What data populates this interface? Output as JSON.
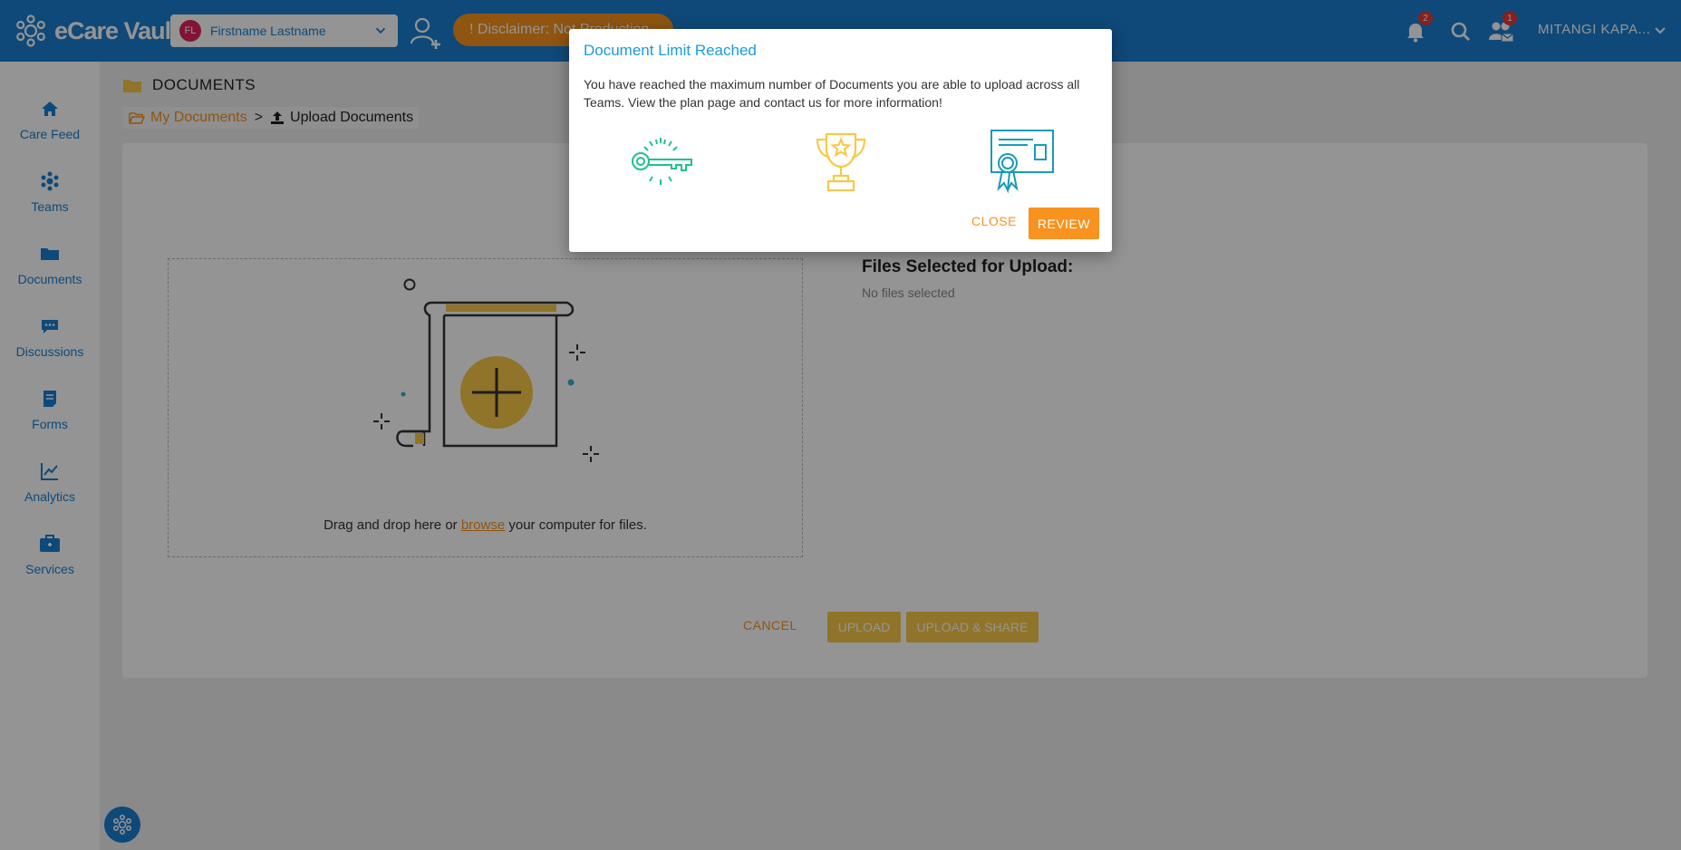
{
  "app": {
    "name": "eCare Vault"
  },
  "header": {
    "team_initials": "FL",
    "team_name": "Firstname Lastname",
    "disclaimer": "! Disclaimer: Not Production",
    "notifications_count": "2",
    "team_requests_count": "1",
    "user_name": "MITANGI KAPA..."
  },
  "sidebar": {
    "items": [
      {
        "label": "Care Feed",
        "icon": "home-icon"
      },
      {
        "label": "Teams",
        "icon": "teams-icon"
      },
      {
        "label": "Documents",
        "icon": "folder-icon"
      },
      {
        "label": "Discussions",
        "icon": "chat-icon"
      },
      {
        "label": "Forms",
        "icon": "form-icon"
      },
      {
        "label": "Analytics",
        "icon": "chart-icon"
      },
      {
        "label": "Services",
        "icon": "briefcase-icon"
      }
    ]
  },
  "page": {
    "title": "DOCUMENTS",
    "breadcrumb": {
      "parent": "My Documents",
      "separator": ">",
      "current": "Upload Documents"
    }
  },
  "upload": {
    "drop_text_before": "Drag and drop here or ",
    "drop_link": "browse",
    "drop_text_after": " your computer for files.",
    "files_title": "Files Selected for Upload:",
    "files_empty": "No files selected",
    "cancel_label": "CANCEL",
    "upload_label": "UPLOAD",
    "upload_share_label": "UPLOAD & SHARE"
  },
  "modal": {
    "title": "Document Limit Reached",
    "body": "You have reached the maximum number of Documents you are able to upload across all Teams. View the plan page and contact us for more information!",
    "icons": [
      "key-icon",
      "trophy-icon",
      "certificate-icon"
    ],
    "close_label": "CLOSE",
    "review_label": "REVIEW"
  },
  "colors": {
    "brand_blue": "#1a7fd1",
    "accent_orange": "#f7931e",
    "accent_yellow": "#f7c948"
  }
}
